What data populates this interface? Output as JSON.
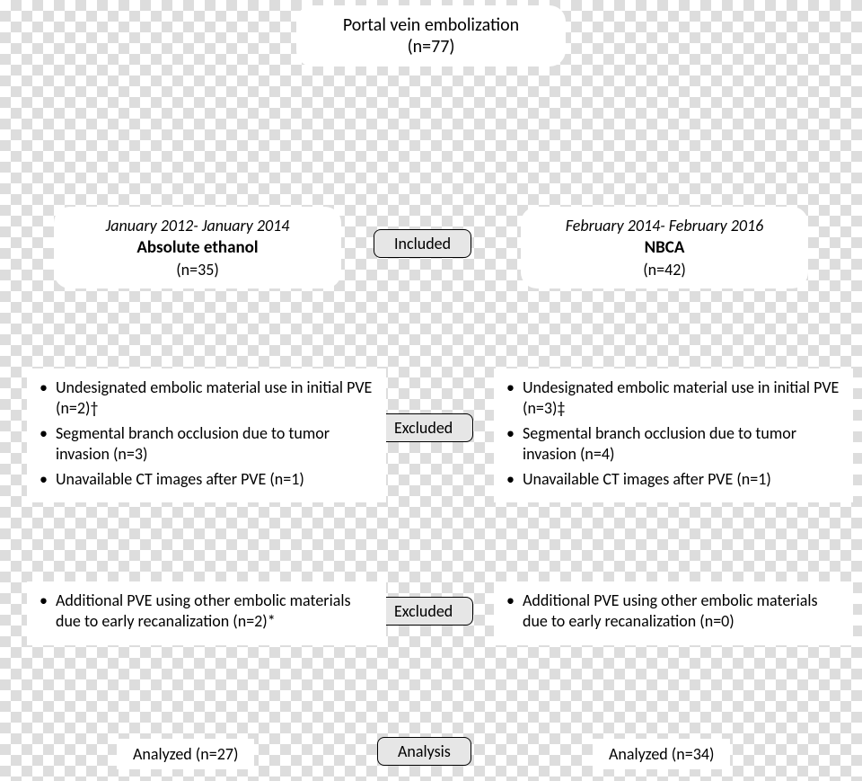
{
  "title": {
    "line1": "Portal vein embolization",
    "n": "(n=77)"
  },
  "tags": {
    "included": "Included",
    "excluded": "Excluded",
    "analysis": "Analysis"
  },
  "groups": {
    "left": {
      "date": "January 2012- January 2014",
      "material": "Absolute ethanol",
      "n": "(n=35)"
    },
    "right": {
      "date": "February 2014- February 2016",
      "material": "NBCA",
      "n": "(n=42)"
    }
  },
  "excl1": {
    "left": {
      "i0": "Undesignated embolic material use in initial PVE (n=2)†",
      "i1": "Segmental branch occlusion due to tumor invasion (n=3)",
      "i2": "Unavailable CT images after PVE (n=1)"
    },
    "right": {
      "i0": "Undesignated embolic material use in initial PVE (n=3)‡",
      "i1": "Segmental branch occlusion due to tumor invasion (n=4)",
      "i2": "Unavailable CT images after PVE (n=1)"
    }
  },
  "excl2": {
    "left": {
      "i0": "Additional PVE using other embolic materials due to early recanalization (n=2)*"
    },
    "right": {
      "i0": "Additional PVE using other embolic materials due to early recanalization (n=0)"
    }
  },
  "analyzed": {
    "left": "Analyzed (n=27)",
    "right": "Analyzed (n=34)"
  }
}
